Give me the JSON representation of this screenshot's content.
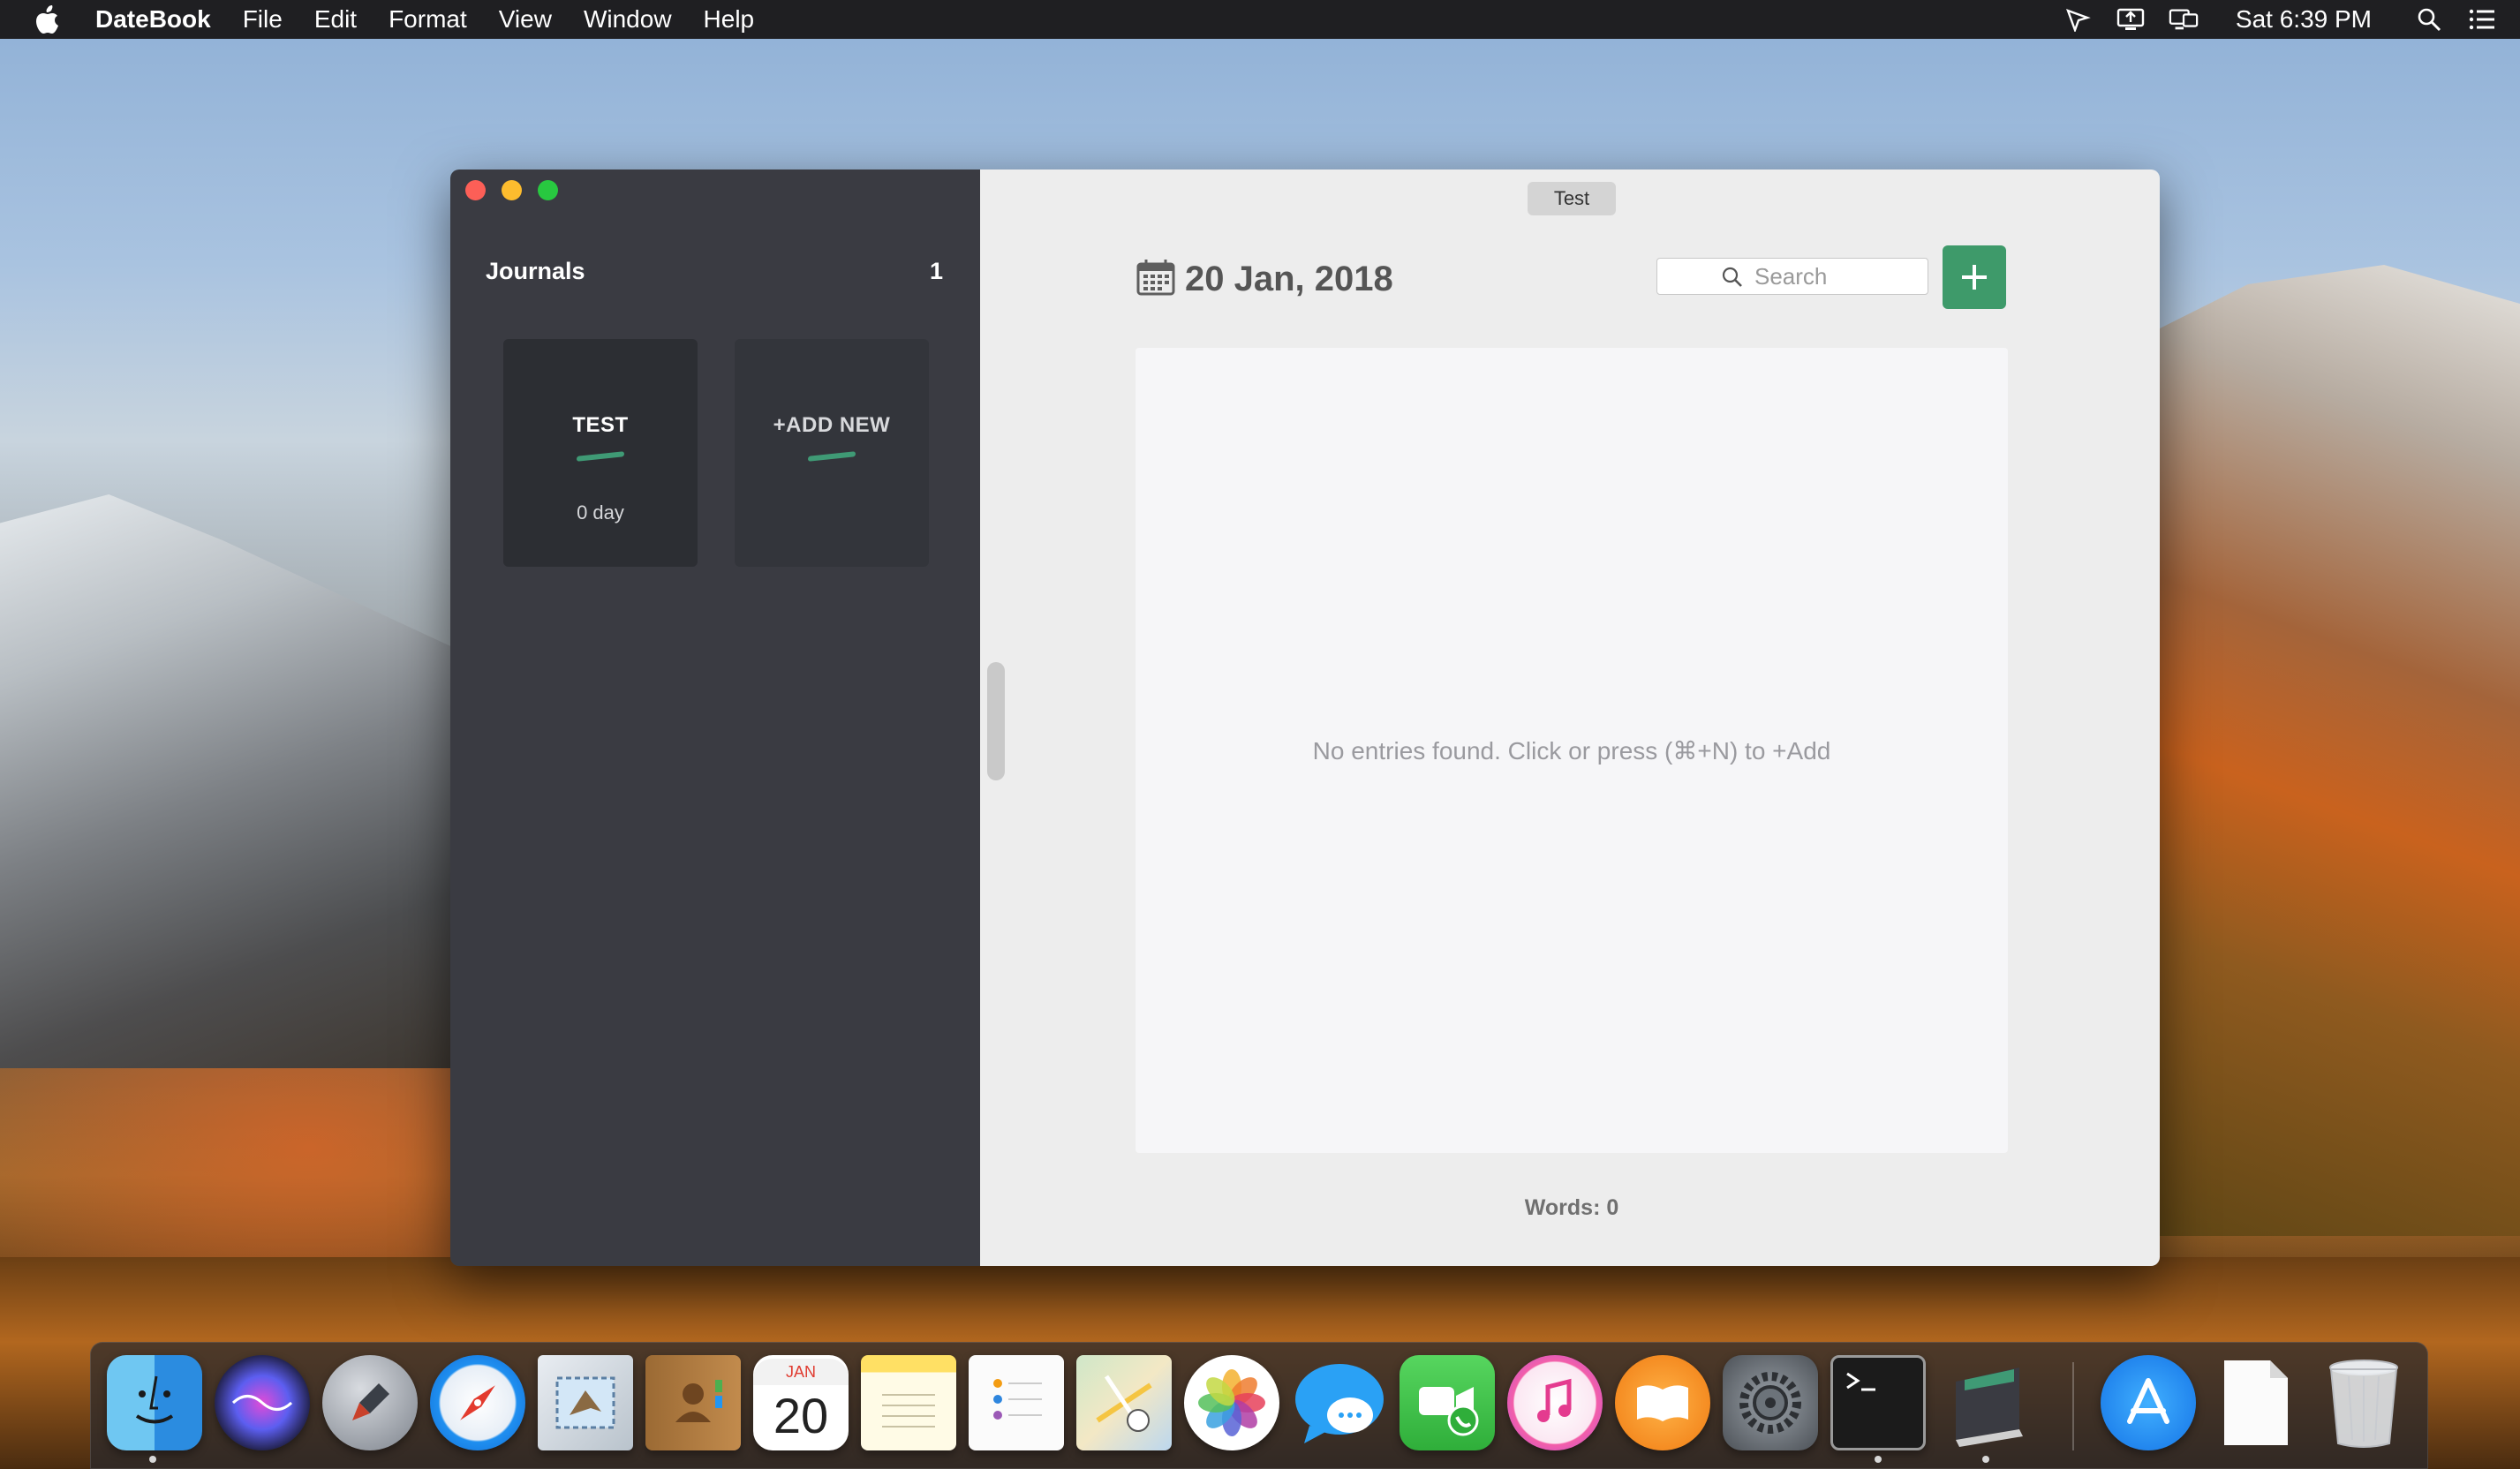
{
  "menubar": {
    "app_name": "DateBook",
    "menus": [
      "File",
      "Edit",
      "Format",
      "View",
      "Window",
      "Help"
    ],
    "clock": "Sat 6:39 PM"
  },
  "window": {
    "title": "Test"
  },
  "sidebar": {
    "header_label": "Journals",
    "journal_count": "1",
    "journals": [
      {
        "title": "TEST",
        "days": "0 day"
      }
    ],
    "add_label": "+ADD NEW"
  },
  "main": {
    "date": "20 Jan, 2018",
    "search_placeholder": "Search",
    "empty_message": "No entries found. Click or press (⌘+N) to +Add",
    "word_count": "Words: 0"
  },
  "colors": {
    "accent_green": "#3e9a6a",
    "sidebar_bg": "#3a3b42",
    "main_bg": "#ededed"
  },
  "dock": {
    "calendar_month": "JAN",
    "calendar_day": "20",
    "apps": [
      "finder-icon",
      "siri-icon",
      "launchpad-icon",
      "safari-icon",
      "mail-icon",
      "contacts-icon",
      "calendar-icon",
      "notes-icon",
      "reminders-icon",
      "maps-icon",
      "photos-icon",
      "messages-icon",
      "facetime-icon",
      "itunes-icon",
      "ibooks-icon",
      "system-preferences-icon",
      "terminal-icon",
      "datebook-icon",
      "app-store-icon",
      "document-icon",
      "trash-icon"
    ]
  }
}
